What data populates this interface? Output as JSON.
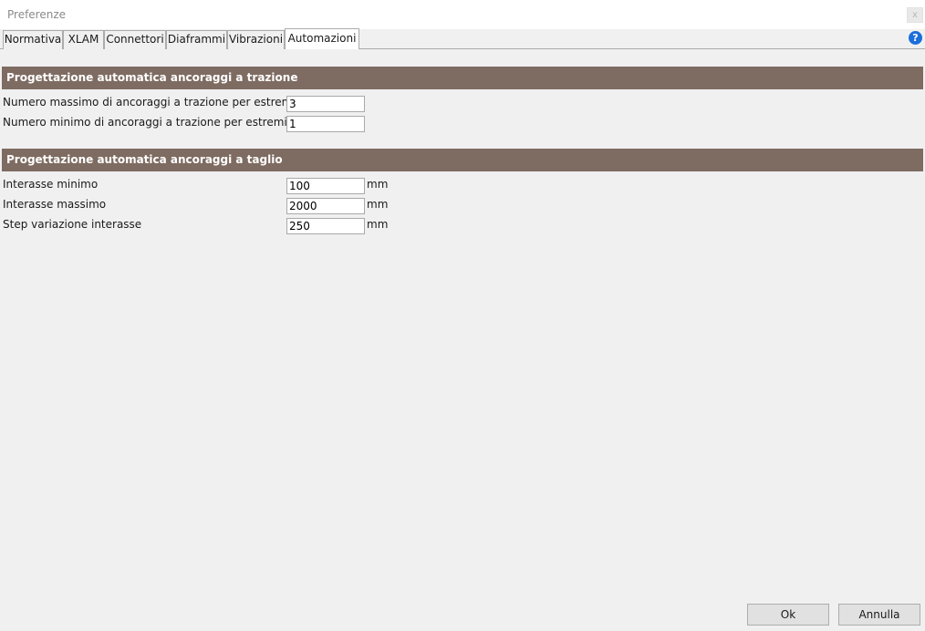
{
  "window": {
    "title": "Preferenze",
    "close_label": "x"
  },
  "tabs": [
    {
      "label": "Normativa",
      "active": false
    },
    {
      "label": "XLAM",
      "active": false
    },
    {
      "label": "Connettori",
      "active": false
    },
    {
      "label": "Diaframmi",
      "active": false
    },
    {
      "label": "Vibrazioni",
      "active": false
    },
    {
      "label": "Automazioni",
      "active": true
    }
  ],
  "help": {
    "glyph": "?"
  },
  "sections": [
    {
      "title": "Progettazione automatica ancoraggi a trazione",
      "fields": [
        {
          "label": "Numero massimo di ancoraggi a trazione per estremità",
          "value": "3",
          "unit": ""
        },
        {
          "label": "Numero minimo di ancoraggi a trazione per estremità",
          "value": "1",
          "unit": ""
        }
      ]
    },
    {
      "title": "Progettazione automatica ancoraggi a taglio",
      "fields": [
        {
          "label": "Interasse minimo",
          "value": "100",
          "unit": "mm"
        },
        {
          "label": "Interasse massimo",
          "value": "2000",
          "unit": "mm"
        },
        {
          "label": "Step variazione interasse",
          "value": "250",
          "unit": "mm"
        }
      ]
    }
  ],
  "footer": {
    "ok_label": "Ok",
    "cancel_label": "Annulla"
  },
  "colors": {
    "section_header": "#7e6b61",
    "help_icon": "#1c6ed9",
    "background": "#f0f0f0"
  }
}
